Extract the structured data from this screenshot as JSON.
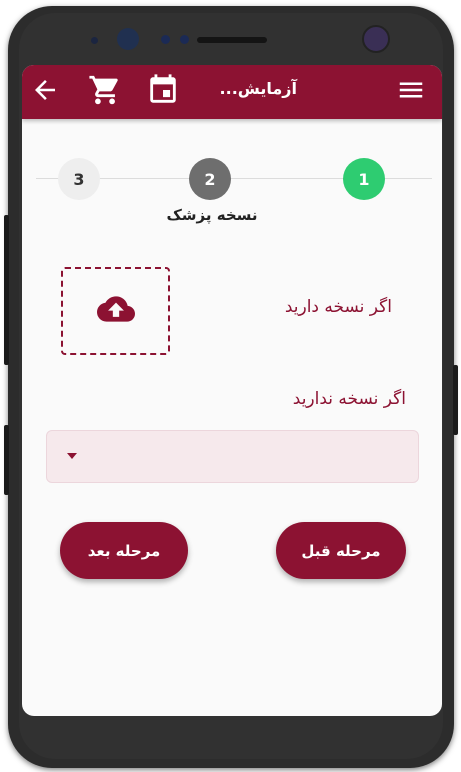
{
  "appbar": {
    "title": "آزمایش...",
    "icons": [
      "back-arrow-icon",
      "cart-icon",
      "calendar-icon",
      "menu-icon"
    ]
  },
  "stepper": {
    "steps": [
      {
        "number": "1",
        "state": "completed"
      },
      {
        "number": "2",
        "state": "active",
        "label": "نسخه پزشک"
      },
      {
        "number": "3",
        "state": "pending"
      }
    ]
  },
  "upload": {
    "has_prescription_label": "اگر نسخه دارید",
    "icon": "cloud-upload-icon"
  },
  "no_prescription": {
    "label": "اگر نسخه ندارید",
    "select_value": ""
  },
  "buttons": {
    "next_label": "مرحله بعد",
    "prev_label": "مرحله قبل"
  },
  "colors": {
    "primary": "#8c1232",
    "step_done": "#2ecc71",
    "step_active": "#6e6e6e",
    "select_bg": "#f6e9ec"
  }
}
